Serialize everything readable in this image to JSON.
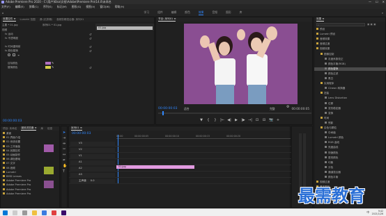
{
  "app": {
    "title": "Adobe Premiere Pro 2020 - C:\\用户\\Kiko\\文档\\Adobe\\Premiere Pro\\14.0\\未命名",
    "window_controls": [
      "—",
      "☐",
      "✕"
    ]
  },
  "menu": [
    "文件(F)",
    "编辑(E)",
    "剪辑(C)",
    "序列(S)",
    "标记(M)",
    "图形(G)",
    "视图(V)",
    "窗口(W)",
    "帮助(H)"
  ],
  "workspaces": {
    "items": [
      "学习",
      "组件",
      "编辑",
      "颜色",
      "效果",
      "音频",
      "图形",
      "库"
    ],
    "active": "效果"
  },
  "effect_controls": {
    "tabs": [
      "效果控件 ≡",
      "Lumetri 范围",
      "源:(无剪辑)",
      "音频剪辑混合器: 序列01"
    ],
    "master": "主要 * 01.jpg",
    "sequence": "序列01 * 01.jpg",
    "clip_tag": "01.jpg",
    "section": "视频",
    "rows": [
      {
        "label": "fx 运动",
        "indent": 1
      },
      {
        "label": "fx 不透明度",
        "indent": 1
      },
      {
        "label": "",
        "indent": 1
      },
      {
        "label": "fx 时间重映射",
        "indent": 1
      },
      {
        "label": "fx 颜色替换",
        "indent": 1
      },
      {
        "label": "",
        "indent": 2
      },
      {
        "label": "",
        "indent": 2
      },
      {
        "label": "目标颜色",
        "indent": 2
      },
      {
        "label": "替换颜色",
        "indent": 2
      },
      {
        "label": "",
        "indent": 2
      }
    ],
    "timecode": "00:00:00:03"
  },
  "program_monitor": {
    "tab": "节目: 序列01 ≡",
    "timecode_left": "00:00:00:03",
    "fit": "适合",
    "quality": "完整",
    "timecode_right": "00:00:00:05",
    "controls": [
      "▼",
      "{",
      "}",
      "|←",
      "◀|",
      "▶",
      "|▶",
      "→|",
      "⊡",
      "⊟",
      "📷",
      "+"
    ]
  },
  "effects_panel": {
    "title": "效果 ≡",
    "search_placeholder": "",
    "tree": [
      {
        "label": "预设",
        "level": 0
      },
      {
        "label": "Lumetri 预设",
        "level": 0
      },
      {
        "label": "音频效果",
        "level": 0
      },
      {
        "label": "音频过渡",
        "level": 0
      },
      {
        "label": "视频效果",
        "level": 0
      },
      {
        "label": "图像控制",
        "level": 1
      },
      {
        "label": "灰度系数校正",
        "level": 2
      },
      {
        "label": "颜色平衡(RGB)",
        "level": 2
      },
      {
        "label": "颜色替换",
        "level": 2,
        "selected": true
      },
      {
        "label": "颜色过滤",
        "level": 2
      },
      {
        "label": "黑白",
        "level": 2
      },
      {
        "label": "实用程序",
        "level": 1
      },
      {
        "label": "Cineon 转换器",
        "level": 2
      },
      {
        "label": "扭曲",
        "level": 1
      },
      {
        "label": "Lens Distortion",
        "level": 2
      },
      {
        "label": "位移",
        "level": 2
      },
      {
        "label": "变形稳定器",
        "level": 2
      },
      {
        "label": "变换",
        "level": 2
      },
      {
        "label": "时间",
        "level": 1
      },
      {
        "label": "残影",
        "level": 2
      },
      {
        "label": "杂色与颗粒",
        "level": 1
      },
      {
        "label": "中间值",
        "level": 2
      },
      {
        "label": "Lumetri 颜色",
        "level": 2
      },
      {
        "label": "RGB 曲线",
        "level": 2
      },
      {
        "label": "亮度曲线",
        "level": 2
      },
      {
        "label": "快速颜色",
        "level": 2
      },
      {
        "label": "更改颜色",
        "level": 2
      },
      {
        "label": "均衡",
        "level": 2
      },
      {
        "label": "分色",
        "level": 2
      },
      {
        "label": "通道混合器",
        "level": 2
      },
      {
        "label": "颜色平衡",
        "level": 2
      },
      {
        "label": "视频过渡",
        "level": 0
      },
      {
        "label": "基本图形",
        "level": 0
      },
      {
        "label": "基本声音",
        "level": 0
      },
      {
        "label": "Lumetri 颜色",
        "level": 0
      }
    ]
  },
  "project_panel": {
    "tabs": [
      "项目: 未命名",
      "媒体浏览器 ≡",
      "库",
      "信息"
    ],
    "items": [
      {
        "label": "桌面"
      },
      {
        "label": "01.界面介绍"
      },
      {
        "label": "02.系统设置"
      },
      {
        "label": "03.工作面板"
      },
      {
        "label": "04.效果控件"
      },
      {
        "label": "05.动画制作"
      },
      {
        "label": "06.调色基础"
      },
      {
        "label": "07.文字"
      },
      {
        "label": "08.音频"
      },
      {
        "label": "Lumetri"
      },
      {
        "label": "BMD Lenses"
      },
      {
        "label": "Adobe Premiere Pro"
      },
      {
        "label": "Adobe Premiere Pro"
      },
      {
        "label": "Adobe Premiere Pro"
      },
      {
        "label": "Adobe Premiere Pro"
      }
    ]
  },
  "timeline": {
    "tab": "序列01 ≡",
    "timecode": "00:00:00:03",
    "ruler": [
      "00:00",
      "00:00:00:05",
      "00:00:00:10",
      "00:00:00:15",
      "00:00:00:20"
    ],
    "tracks": [
      {
        "name": "V3"
      },
      {
        "name": "V2"
      },
      {
        "name": "V1",
        "clip": "01.jpg"
      },
      {
        "name": "A1"
      },
      {
        "name": "A2"
      },
      {
        "name": "A3"
      },
      {
        "name": "主声道",
        "value": "0.0"
      }
    ]
  },
  "taskbar": {
    "time": "9:42",
    "date": "2021/1/26",
    "lang": "中"
  },
  "watermark": "最需教育"
}
